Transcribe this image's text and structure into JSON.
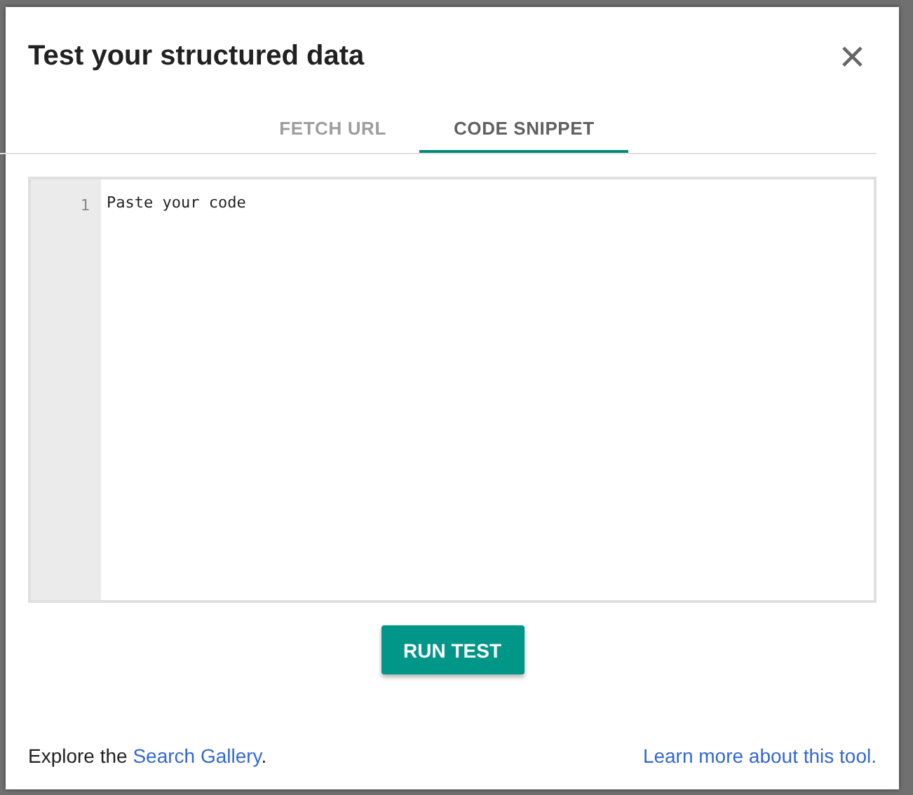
{
  "dialog": {
    "title": "Test your structured data",
    "close": "×"
  },
  "tabs": [
    {
      "label": "FETCH URL",
      "selected": false
    },
    {
      "label": "CODE SNIPPET",
      "selected": true
    }
  ],
  "editor": {
    "line_numbers": [
      "1"
    ],
    "placeholder": "Paste your code"
  },
  "run_button": "RUN TEST",
  "footer": {
    "left": {
      "prefix": "Explore the ",
      "link": "Search Gallery",
      "suffix": "."
    },
    "right_link": "Learn more about this tool."
  }
}
